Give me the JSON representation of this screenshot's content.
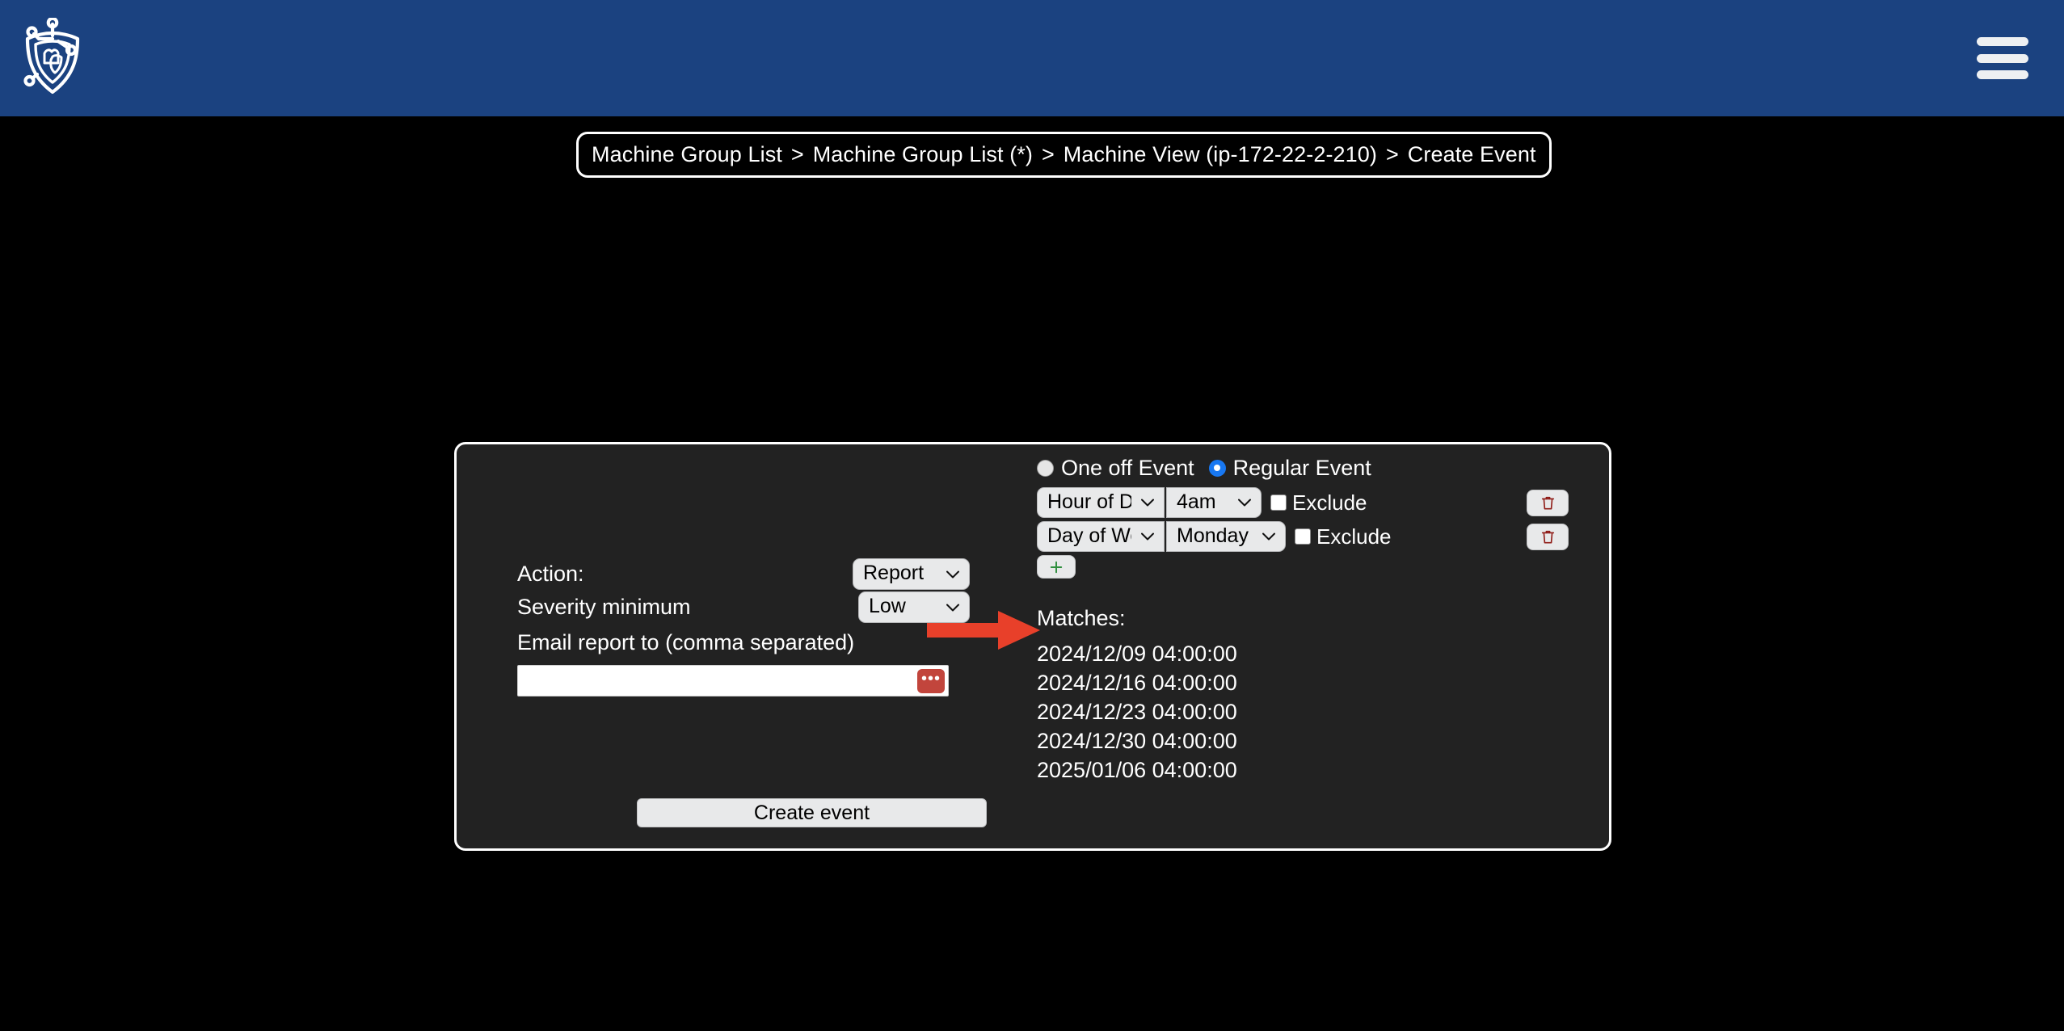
{
  "header": {
    "logo_name": "shield-network-logo",
    "menu_label": "Menu",
    "background_color": "#1b4280"
  },
  "breadcrumb": {
    "separator": ">",
    "items": [
      {
        "label": "Machine Group List"
      },
      {
        "label": "Machine Group List (*)"
      },
      {
        "label": "Machine View (ip-172-22-2-210)"
      },
      {
        "label": "Create Event"
      }
    ]
  },
  "form": {
    "action": {
      "label": "Action:",
      "value": "Report",
      "options": [
        "Report"
      ]
    },
    "severity": {
      "label": "Severity minimum",
      "value": "Low",
      "options": [
        "Low"
      ]
    },
    "email": {
      "label": "Email report to (comma separated)",
      "value": "",
      "placeholder": "",
      "autofill_label": "•••"
    },
    "event_type": {
      "one_off_label": "One off Event",
      "regular_label": "Regular Event",
      "selected": "Regular Event"
    },
    "rules": [
      {
        "type": "Hour of Day",
        "value": "4am",
        "exclude_label": "Exclude",
        "exclude_checked": false,
        "delete_title": "Delete rule"
      },
      {
        "type": "Day of Week",
        "value": "Monday",
        "exclude_label": "Exclude",
        "exclude_checked": false,
        "delete_title": "Delete rule"
      }
    ],
    "add_rule_label": "+",
    "matches": {
      "title": "Matches:",
      "entries": [
        "2024/12/09 04:00:00",
        "2024/12/16 04:00:00",
        "2024/12/23 04:00:00",
        "2024/12/30 04:00:00",
        "2025/01/06 04:00:00"
      ]
    },
    "submit_label": "Create event"
  },
  "annotation": {
    "arrow_name": "annotation-arrow-to-action-select",
    "arrow_color": "#e8402a"
  },
  "colors": {
    "page_background": "#000000",
    "card_background": "#222222",
    "control_background": "#e8e9ea",
    "accent_blue": "#1878f2",
    "danger_red": "#8f1b16"
  }
}
